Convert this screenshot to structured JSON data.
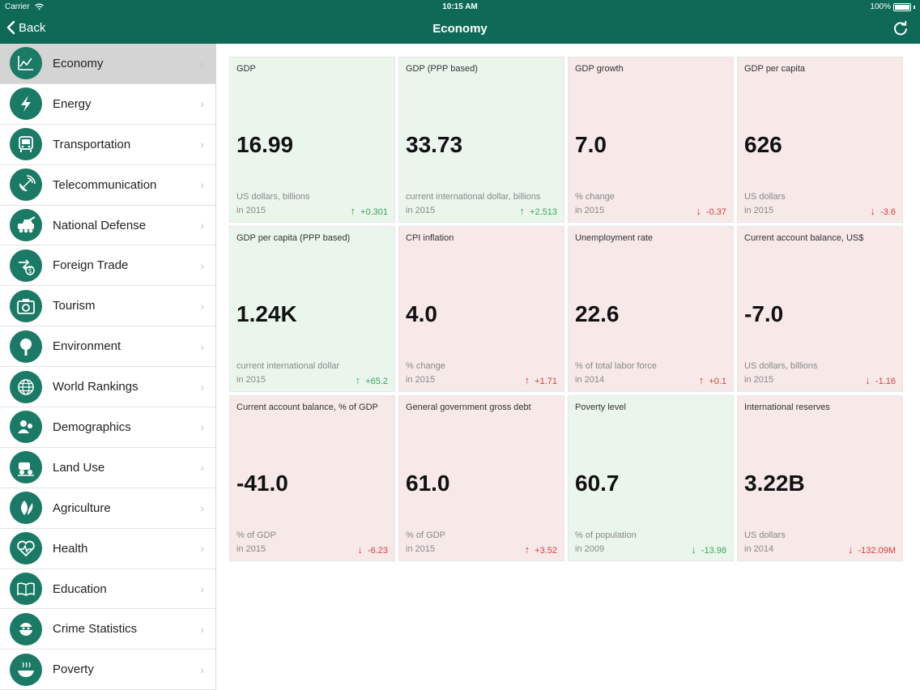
{
  "status_bar": {
    "carrier": "Carrier",
    "time": "10:15 AM",
    "battery": "100%"
  },
  "nav": {
    "back_label": "Back",
    "title": "Economy"
  },
  "colors": {
    "brand": "#0e6a57",
    "icon_bg": "#1a7a66",
    "up_bg": "#eaf6ec",
    "down_bg": "#f6e9e8",
    "up_text": "#3aa35a",
    "down_text": "#d64040"
  },
  "sidebar": {
    "items": [
      {
        "label": "Economy",
        "icon": "economy-icon"
      },
      {
        "label": "Energy",
        "icon": "energy-icon"
      },
      {
        "label": "Transportation",
        "icon": "transportation-icon"
      },
      {
        "label": "Telecommunication",
        "icon": "telecommunication-icon"
      },
      {
        "label": "National Defense",
        "icon": "national-defense-icon"
      },
      {
        "label": "Foreign Trade",
        "icon": "foreign-trade-icon"
      },
      {
        "label": "Tourism",
        "icon": "tourism-icon"
      },
      {
        "label": "Environment",
        "icon": "environment-icon"
      },
      {
        "label": "World Rankings",
        "icon": "world-rankings-icon"
      },
      {
        "label": "Demographics",
        "icon": "demographics-icon"
      },
      {
        "label": "Land Use",
        "icon": "land-use-icon"
      },
      {
        "label": "Agriculture",
        "icon": "agriculture-icon"
      },
      {
        "label": "Health",
        "icon": "health-icon"
      },
      {
        "label": "Education",
        "icon": "education-icon"
      },
      {
        "label": "Crime Statistics",
        "icon": "crime-statistics-icon"
      },
      {
        "label": "Poverty",
        "icon": "poverty-icon"
      }
    ]
  },
  "tiles": [
    {
      "title": "GDP",
      "value": "16.99",
      "unit": "US dollars, billions",
      "year": "in 2015",
      "change": "+0.301",
      "trend": "up",
      "color": "up"
    },
    {
      "title": "GDP (PPP based)",
      "value": "33.73",
      "unit": "current international dollar, billions",
      "year": "in 2015",
      "change": "+2.513",
      "trend": "up",
      "color": "up"
    },
    {
      "title": "GDP growth",
      "value": "7.0",
      "unit": "% change",
      "year": "in 2015",
      "change": "-0.37",
      "trend": "down",
      "color": "down"
    },
    {
      "title": "GDP per capita",
      "value": "626",
      "unit": "US dollars",
      "year": "in 2015",
      "change": "-3.6",
      "trend": "down",
      "color": "down"
    },
    {
      "title": "GDP per capita (PPP based)",
      "value": "1.24K",
      "unit": "current international dollar",
      "year": "in 2015",
      "change": "+65.2",
      "trend": "up",
      "color": "up"
    },
    {
      "title": "CPI inflation",
      "value": "4.0",
      "unit": "% change",
      "year": "in 2015",
      "change": "+1.71",
      "trend": "up",
      "color": "down"
    },
    {
      "title": "Unemployment rate",
      "value": "22.6",
      "unit": "% of total labor force",
      "year": "in 2014",
      "change": "+0.1",
      "trend": "up",
      "color": "down"
    },
    {
      "title": "Current account balance, US$",
      "value": "-7.0",
      "unit": "US dollars, billions",
      "year": "in 2015",
      "change": "-1.16",
      "trend": "down",
      "color": "down"
    },
    {
      "title": "Current account balance, % of GDP",
      "value": "-41.0",
      "unit": "% of GDP",
      "year": "in 2015",
      "change": "-6.23",
      "trend": "down",
      "color": "down"
    },
    {
      "title": "General government gross debt",
      "value": "61.0",
      "unit": "% of GDP",
      "year": "in 2015",
      "change": "+3.52",
      "trend": "up",
      "color": "down"
    },
    {
      "title": "Poverty level",
      "value": "60.7",
      "unit": "% of population",
      "year": "in 2009",
      "change": "-13.98",
      "trend": "down",
      "color": "up"
    },
    {
      "title": "International reserves",
      "value": "3.22B",
      "unit": "US dollars",
      "year": "in 2014",
      "change": "-132.09M",
      "trend": "down",
      "color": "down"
    }
  ]
}
